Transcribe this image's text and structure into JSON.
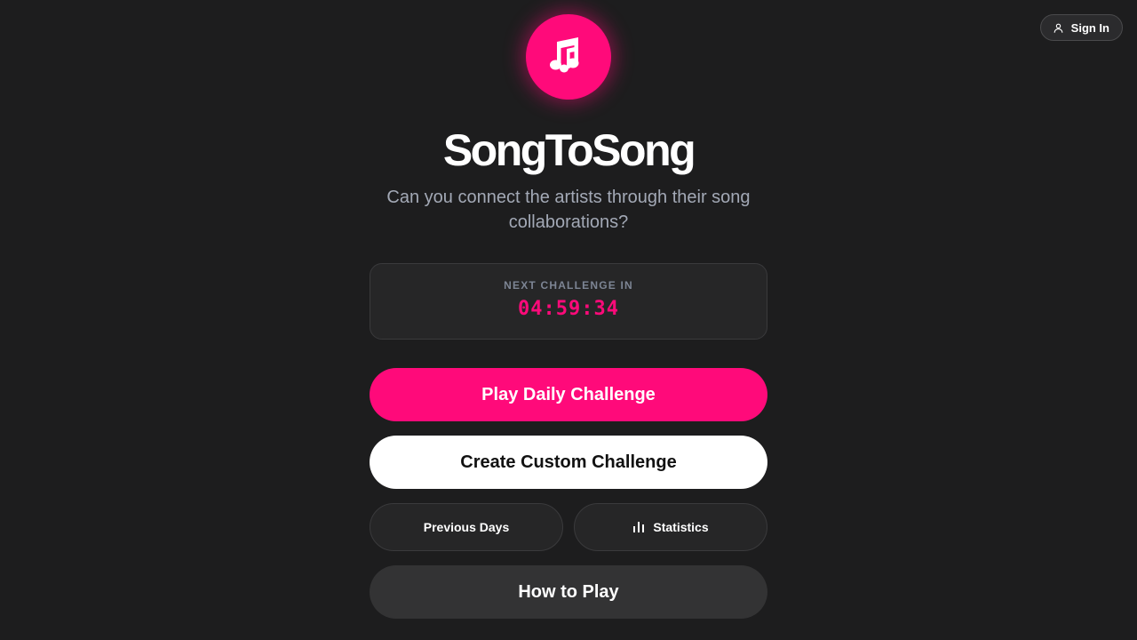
{
  "header": {
    "signin_label": "Sign In",
    "signin_icon": "user-icon"
  },
  "logo": {
    "icon": "music-notes-icon",
    "color": "#ff0a7a"
  },
  "app": {
    "title": "SongToSong",
    "subtitle": "Can you connect the artists through their song collaborations?"
  },
  "countdown": {
    "label": "NEXT CHALLENGE IN",
    "time": "04:59:34"
  },
  "actions": {
    "daily_label": "Play Daily Challenge",
    "custom_label": "Create Custom Challenge",
    "previous_label": "Previous Days",
    "statistics_label": "Statistics",
    "statistics_icon": "bar-chart-icon",
    "how_to_play_label": "How to Play"
  },
  "colors": {
    "accent": "#ff0a7a",
    "background": "#1d1d1e",
    "surface": "#262627",
    "muted_text": "#a3a9b6"
  }
}
